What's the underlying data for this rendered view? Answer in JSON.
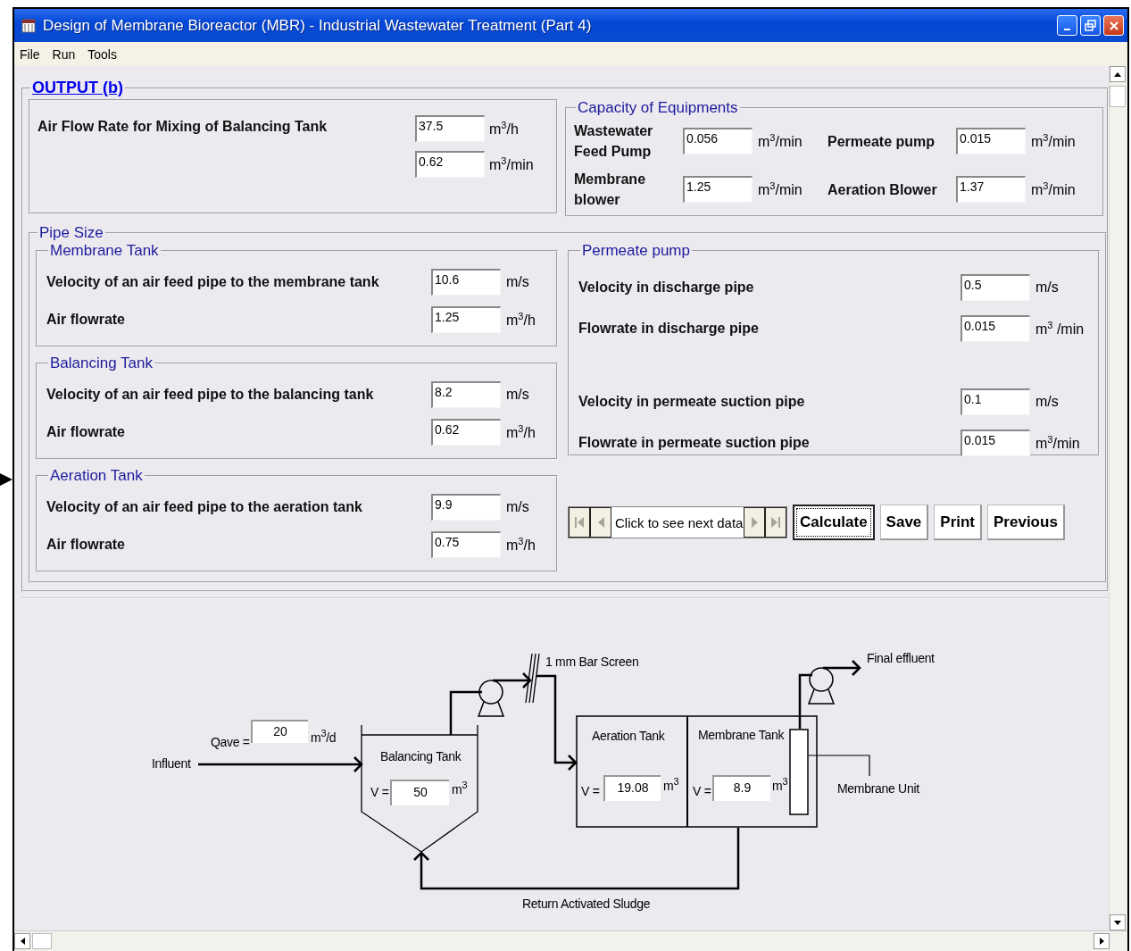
{
  "window": {
    "title": "Design of Membrane Bioreactor (MBR) - Industrial Wastewater Treatment (Part 4)",
    "menu": [
      "File",
      "Run",
      "Tools"
    ]
  },
  "output": {
    "title": "OUTPUT (b)",
    "air_flow": {
      "label": "Air Flow Rate for Mixing of Balancing Tank",
      "fields": [
        {
          "value": "37.5",
          "unit": "m$^{3}$/h"
        },
        {
          "value": "0.62",
          "unit": "m$^{3}$/min"
        }
      ]
    },
    "capacity": {
      "title": "Capacity of  Equipments",
      "items": [
        {
          "label": "Wastewater Feed Pump",
          "value": "0.056",
          "unit": "m$^{3}$/min"
        },
        {
          "label": "Permeate pump",
          "value": "0.015",
          "unit": "m$^{3}$/min"
        },
        {
          "label": "Membrane blower",
          "value": "1.25",
          "unit": "m$^{3}$/min"
        },
        {
          "label": "Aeration Blower",
          "value": "1.37",
          "unit": "m$^{3}$/min"
        }
      ]
    },
    "pipe_size": {
      "title": "Pipe Size",
      "groups": [
        {
          "title": "Membrane Tank",
          "rows": [
            {
              "label": "Velocity of an air feed pipe to the membrane tank",
              "value": "10.6",
              "unit": "m/s"
            },
            {
              "label": "Air flowrate",
              "value": "1.25",
              "unit": "m$^{3}$/h"
            }
          ]
        },
        {
          "title": "Balancing Tank",
          "rows": [
            {
              "label": "Velocity of an air feed pipe to the balancing tank",
              "value": "8.2",
              "unit": "m/s"
            },
            {
              "label": "Air flowrate",
              "value": "0.62",
              "unit": "m$^{3}$/h"
            }
          ]
        },
        {
          "title": "Aeration Tank",
          "rows": [
            {
              "label": "Velocity of an air feed pipe to the aeration tank",
              "value": "9.9",
              "unit": "m/s"
            },
            {
              "label": "Air flowrate",
              "value": "0.75",
              "unit": "m$^{3}$/h"
            }
          ]
        }
      ],
      "permeate": {
        "title": "Permeate pump",
        "sections": [
          {
            "rows": [
              {
                "label": "Velocity in discharge pipe",
                "value": "0.5",
                "unit": "m/s"
              },
              {
                "label": "Flowrate in discharge pipe",
                "value": "0.015",
                "unit": "m$^{3}$ /min"
              }
            ]
          },
          {
            "rows": [
              {
                "label": "Velocity in permeate suction pipe",
                "value": "0.1",
                "unit": "m/s"
              },
              {
                "label": "Flowrate in permeate suction pipe",
                "value": "0.015",
                "unit": "m$^{3}$/min"
              }
            ]
          }
        ]
      }
    }
  },
  "navigator": {
    "caption": "Click to see next data"
  },
  "buttons": [
    {
      "label": "Calculate",
      "focused": true
    },
    {
      "label": "Save",
      "focused": false
    },
    {
      "label": "Print",
      "focused": false
    },
    {
      "label": "Previous",
      "focused": false
    }
  ],
  "diagram": {
    "influent": "Influent",
    "qave": {
      "label": "Qave =",
      "value": "20",
      "unit": "m$^{3}$/d"
    },
    "bar_screen": "1 mm Bar Screen",
    "final_effluent": "Final effluent",
    "balancing_tank": {
      "name": "Balancing Tank",
      "label": "V =",
      "value": "50",
      "unit": "m$^{3}$"
    },
    "aeration_tank": {
      "name": "Aeration Tank",
      "label": "V =",
      "value": "19.08",
      "unit": "m$^{3}$"
    },
    "membrane_tank": {
      "name": "Membrane Tank",
      "label": "V =",
      "value": "8.9",
      "unit": "m$^{3}$"
    },
    "membrane_unit": "Membrane Unit",
    "return_sludge": "Return Activated Sludge"
  }
}
